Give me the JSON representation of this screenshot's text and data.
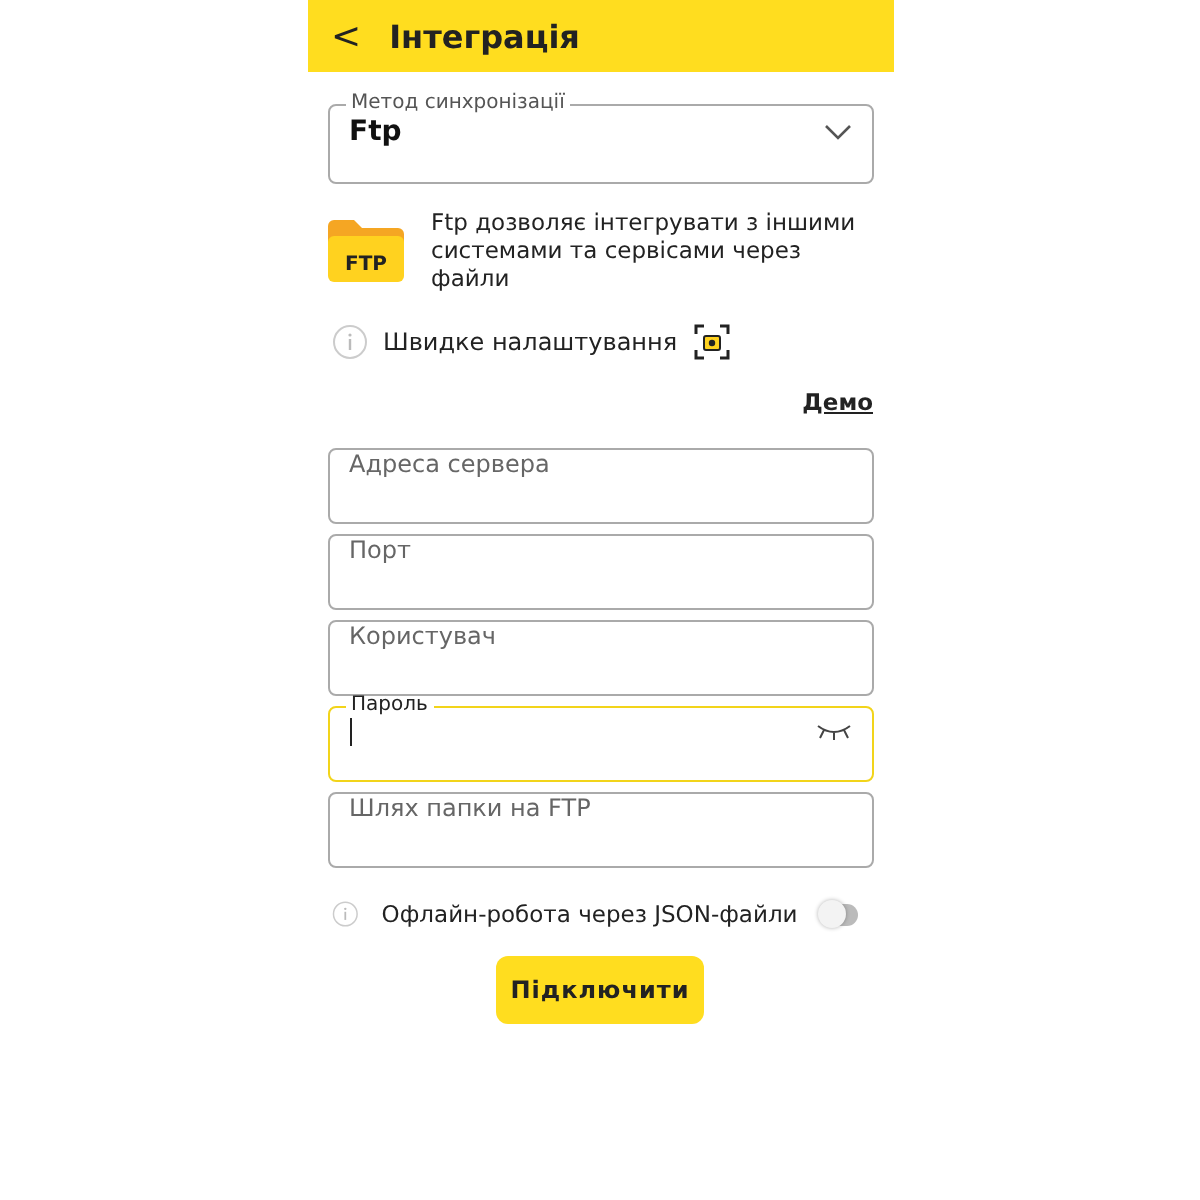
{
  "header": {
    "back": "<",
    "title": "Інтеграція"
  },
  "sync_method": {
    "label": "Метод синхронізації",
    "value": "Ftp"
  },
  "info": {
    "badge": "FTP",
    "text": "Ftp дозволяє інтегрувати з іншими системами та сервісами через файли"
  },
  "quick_setup": {
    "label": "Швидке налаштування"
  },
  "demo_link": "Демо",
  "fields": [
    {
      "kind": "text",
      "placeholder": "Адреса сервера",
      "focused": false
    },
    {
      "kind": "text",
      "placeholder": "Порт",
      "focused": false
    },
    {
      "kind": "text",
      "placeholder": "Користувач",
      "focused": false
    },
    {
      "kind": "password",
      "label": "Пароль",
      "focused": true
    },
    {
      "kind": "text",
      "placeholder": "Шлях папки на FTP",
      "focused": false
    }
  ],
  "offline": {
    "label": "Офлайн-робота через JSON-файли",
    "on": false
  },
  "connect_button": "Підключити"
}
